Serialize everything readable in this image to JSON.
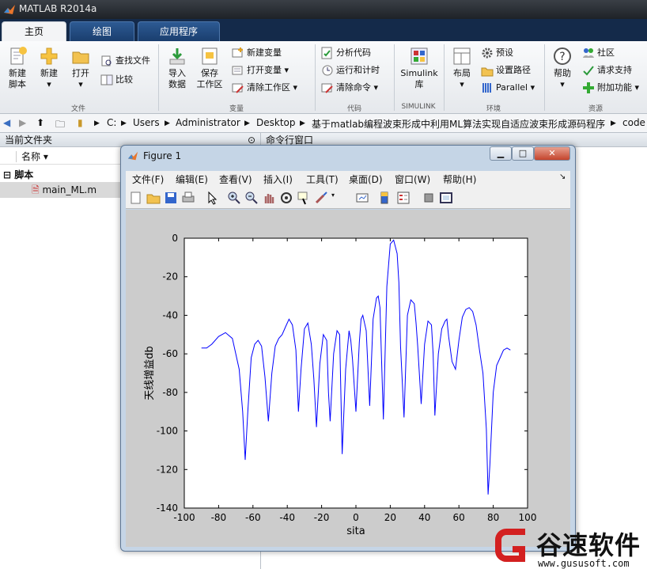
{
  "window": {
    "title": "MATLAB R2014a"
  },
  "tabs": [
    {
      "label": "主页"
    },
    {
      "label": "绘图"
    },
    {
      "label": "应用程序"
    }
  ],
  "ribbon": {
    "new_script": "新建\n脚本",
    "new_script_l1": "新建",
    "new_script_l2": "脚本",
    "new": "新建",
    "open": "打开",
    "find_files": "查找文件",
    "compare": "比较",
    "import_l1": "导入",
    "import_l2": "数据",
    "save_ws_l1": "保存",
    "save_ws_l2": "工作区",
    "new_var": "新建变量",
    "open_var": "打开变量",
    "clear_ws": "清除工作区",
    "analyze_code": "分析代码",
    "run_time": "运行和计时",
    "clear_cmd": "清除命令",
    "simulink_l1": "Simulink",
    "simulink_l2": "库",
    "layout": "布局",
    "prefs": "预设",
    "set_path": "设置路径",
    "parallel": "Parallel",
    "help": "帮助",
    "community": "社区",
    "request_support": "请求支持",
    "addons": "附加功能",
    "sections": {
      "file": "文件",
      "variable": "变量",
      "code": "代码",
      "simulink": "SIMULINK",
      "env": "环境",
      "resources": "资源"
    }
  },
  "address": {
    "crumbs": [
      "C:",
      "Users",
      "Administrator",
      "Desktop",
      "基于matlab编程波束形成中利用ML算法实现自适应波束形成源码程序",
      "code"
    ]
  },
  "left_pane": {
    "title": "当前文件夹",
    "col_name": "名称",
    "group": "脚本",
    "file": "main_ML.m"
  },
  "cmd_pane": {
    "title": "命令行窗口"
  },
  "figure": {
    "title": "Figure 1",
    "menus": [
      "文件(F)",
      "编辑(E)",
      "查看(V)",
      "插入(I)",
      "工具(T)",
      "桌面(D)",
      "窗口(W)",
      "帮助(H)"
    ]
  },
  "chart_data": {
    "type": "line",
    "xlabel": "sita",
    "ylabel": "天线增益db",
    "xlim": [
      -100,
      100
    ],
    "ylim": [
      -140,
      0
    ],
    "xticks": [
      "-100",
      "-80",
      "-60",
      "-40",
      "-20",
      "0",
      "20",
      "40",
      "60",
      "80",
      "100"
    ],
    "yticks": [
      "0",
      "-20",
      "-40",
      "-60",
      "-80",
      "-100",
      "-120",
      "-140"
    ],
    "series": [
      {
        "color": "#0000ff",
        "x": [
          -90,
          -87,
          -84,
          -80,
          -76,
          -72,
          -68,
          -66,
          -64.5,
          -63,
          -61,
          -59,
          -57,
          -55,
          -53,
          -51,
          -49,
          -47,
          -45,
          -43,
          -41,
          -39,
          -37,
          -35,
          -33.5,
          -32,
          -30,
          -28,
          -26,
          -24.5,
          -23,
          -21,
          -19,
          -17,
          -16,
          -15,
          -13,
          -11,
          -9.5,
          -8,
          -6,
          -4,
          -3,
          -2,
          0,
          2,
          3,
          4,
          6,
          8,
          10,
          12,
          13,
          14,
          16,
          18,
          20,
          22,
          24,
          25,
          26,
          28,
          30,
          32,
          34,
          35,
          36,
          38,
          40,
          42,
          44,
          45,
          46,
          48,
          50,
          52,
          53,
          54,
          56,
          58,
          60,
          62,
          64,
          66,
          68,
          70,
          72,
          74,
          76,
          77,
          78,
          80,
          82,
          84,
          86,
          88,
          90
        ],
        "y": [
          -57,
          -57,
          -55,
          -51,
          -49,
          -52,
          -68,
          -90,
          -115,
          -90,
          -62,
          -55,
          -53,
          -56,
          -72,
          -95,
          -70,
          -56,
          -52,
          -50,
          -46,
          -42,
          -45,
          -58,
          -90,
          -68,
          -47,
          -44,
          -55,
          -73,
          -98,
          -65,
          -50,
          -53,
          -80,
          -95,
          -60,
          -48,
          -50,
          -112,
          -68,
          -48,
          -53,
          -63,
          -90,
          -54,
          -42,
          -40,
          -48,
          -87,
          -42,
          -31,
          -30,
          -36,
          -94,
          -25,
          -3,
          -1,
          -8,
          -23,
          -56,
          -93,
          -40,
          -32,
          -34,
          -44,
          -56,
          -86,
          -55,
          -43,
          -45,
          -60,
          -92,
          -60,
          -47,
          -43,
          -42,
          -51,
          -64,
          -68,
          -53,
          -41,
          -37,
          -36,
          -38,
          -45,
          -58,
          -70,
          -99,
          -133,
          -118,
          -80,
          -66,
          -62,
          -58,
          -57,
          -58
        ]
      }
    ]
  },
  "brand": {
    "name": "谷速软件",
    "url": "www.gususoft.com",
    "color": "#d32020"
  }
}
